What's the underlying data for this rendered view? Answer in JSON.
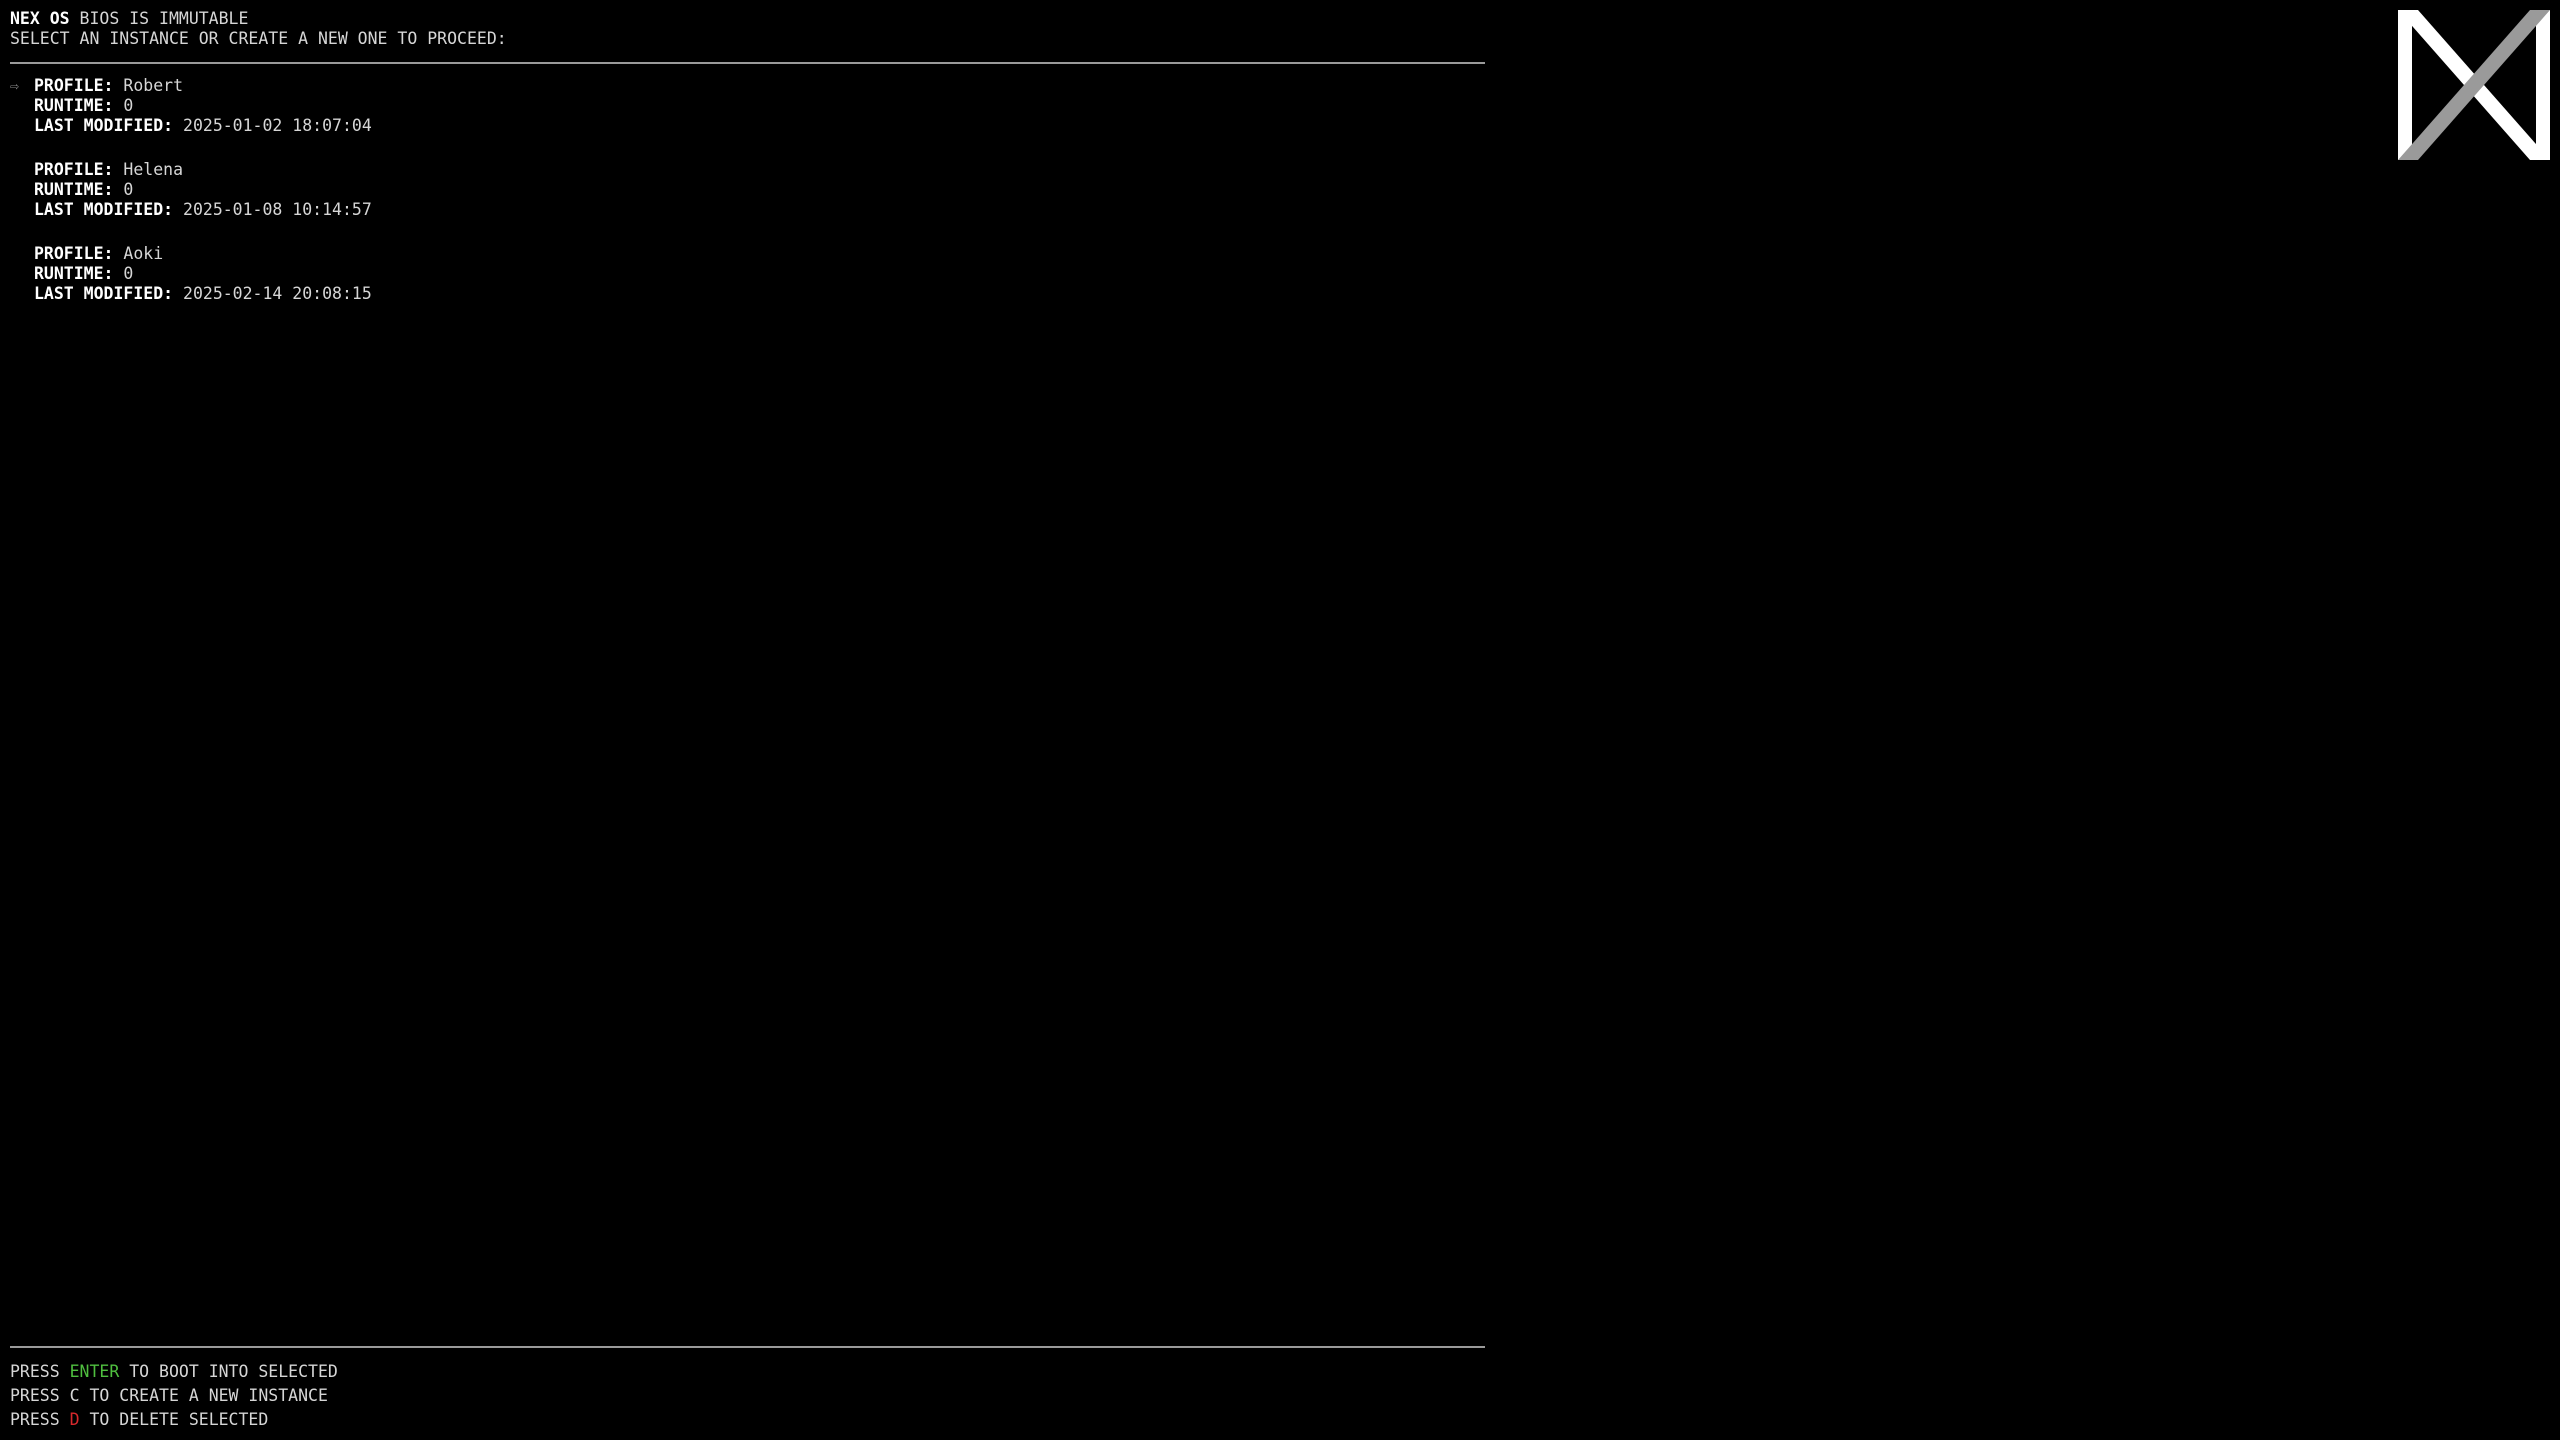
{
  "header": {
    "brand": "NEX OS",
    "notice": "BIOS IS IMMUTABLE",
    "instruction": "SELECT AN INSTANCE OR CREATE A NEW ONE TO PROCEED:"
  },
  "labels": {
    "profile": "PROFILE:",
    "runtime": "RUNTIME:",
    "last_modified": "LAST MODIFIED:"
  },
  "selection_cursor": "⇨",
  "selected_index": 0,
  "profiles": [
    {
      "name": "Robert",
      "runtime": "0",
      "last_modified": "2025-01-02 18:07:04"
    },
    {
      "name": "Helena",
      "runtime": "0",
      "last_modified": "2025-01-08 10:14:57"
    },
    {
      "name": "Aoki",
      "runtime": "0",
      "last_modified": "2025-02-14 20:08:15"
    }
  ],
  "footer": {
    "boot": {
      "prefix": "PRESS",
      "key": "ENTER",
      "suffix": "TO BOOT INTO SELECTED"
    },
    "create": {
      "prefix": "PRESS",
      "key": "C",
      "suffix": "TO CREATE A NEW INSTANCE"
    },
    "delete": {
      "prefix": "PRESS",
      "key": "D",
      "suffix": "TO DELETE SELECTED"
    }
  },
  "colors": {
    "background": "#000000",
    "text": "#d6d6d6",
    "enter_key": "#4fbf3f",
    "delete_key": "#d8282c",
    "logo_white": "#ffffff",
    "logo_gray": "#9a9a9a"
  },
  "logo_icon": "nex-logo-icon"
}
